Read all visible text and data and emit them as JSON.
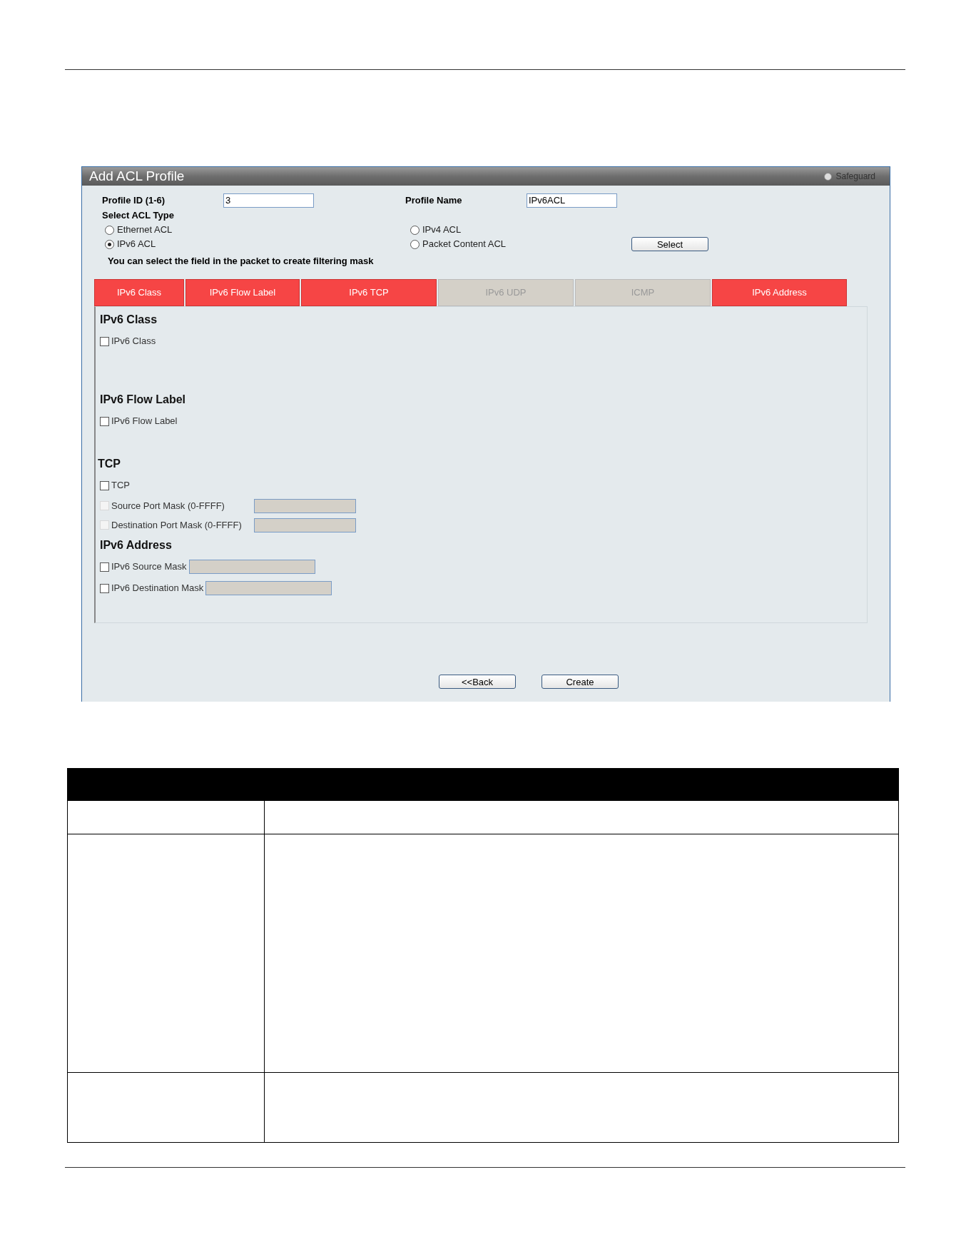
{
  "window": {
    "title": "Add ACL Profile",
    "safeguard": {
      "label": "Safeguard",
      "on": false
    }
  },
  "profile_id": {
    "label": "Profile ID (1-6)",
    "value": "3"
  },
  "profile_name": {
    "label": "Profile Name",
    "value": "IPv6ACL"
  },
  "acl_type": {
    "label": "Select ACL Type",
    "options": [
      {
        "label": "Ethernet ACL",
        "selected": false
      },
      {
        "label": "IPv4 ACL",
        "selected": false
      },
      {
        "label": "IPv6 ACL",
        "selected": true
      },
      {
        "label": "Packet Content ACL",
        "selected": false
      }
    ]
  },
  "select_button": "Select",
  "hint": "You can select the field in the packet to create filtering mask",
  "tabs": [
    {
      "label": "IPv6 Class",
      "enabled": true
    },
    {
      "label": "IPv6 Flow Label",
      "enabled": true
    },
    {
      "label": "IPv6 TCP",
      "enabled": true
    },
    {
      "label": "IPv6 UDP",
      "enabled": false
    },
    {
      "label": "ICMP",
      "enabled": false
    },
    {
      "label": "IPv6 Address",
      "enabled": true
    }
  ],
  "sections": [
    {
      "title": "IPv6 Class",
      "fields": [
        {
          "kind": "checkbox",
          "label": "IPv6 Class",
          "checked": false,
          "disabled": false
        }
      ]
    },
    {
      "title": "IPv6 Flow Label",
      "fields": [
        {
          "kind": "checkbox",
          "label": "IPv6 Flow Label",
          "checked": false,
          "disabled": false
        }
      ]
    },
    {
      "title": "TCP",
      "fields": [
        {
          "kind": "checkbox",
          "label": "TCP",
          "checked": false,
          "disabled": false
        },
        {
          "kind": "aligned_input",
          "label": "Source Port Mask (0-FFFF)",
          "checked": false,
          "disabled": true,
          "input_disabled": true
        },
        {
          "kind": "aligned_input",
          "label": "Destination Port Mask (0-FFFF)",
          "checked": false,
          "disabled": true,
          "input_disabled": true
        }
      ]
    },
    {
      "title": "IPv6 Address",
      "fields": [
        {
          "kind": "inline_input",
          "label": "IPv6 Source Mask",
          "checked": false,
          "disabled": false,
          "input_disabled": true
        },
        {
          "kind": "inline_input",
          "label": "IPv6 Destination Mask",
          "checked": false,
          "disabled": false,
          "input_disabled": true
        }
      ]
    }
  ],
  "buttons": [
    "<<Back",
    "Create"
  ]
}
